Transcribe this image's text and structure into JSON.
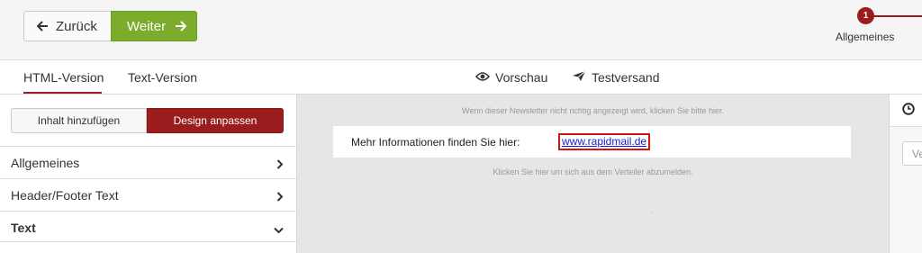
{
  "toolbar": {
    "back_label": "Zurück",
    "next_label": "Weiter",
    "step": {
      "number": "1",
      "label": "Allgemeines"
    }
  },
  "tabs": {
    "html_label": "HTML-Version",
    "text_label": "Text-Version",
    "preview_label": "Vorschau",
    "testsend_label": "Testversand"
  },
  "sidebar": {
    "segment": {
      "add_content": "Inhalt hinzufügen",
      "customize_design": "Design anpassen"
    },
    "items": [
      {
        "label": "Allgemeines"
      },
      {
        "label": "Header/Footer Text"
      },
      {
        "label": "Text"
      }
    ]
  },
  "preview": {
    "notice": "Wenn dieser Newsletter nicht richtig angezeigt wird, klicken Sie bitte hier.",
    "body_text": "Mehr Informationen finden Sie hier:",
    "link_text": "www.rapidmail.de",
    "unsubscribe": "Klicken Sie hier um sich aus dem Verteiler abzumelden."
  },
  "right_panel": {
    "field_text": "Ve"
  },
  "colors": {
    "accent_red": "#9b1c1c",
    "next_green": "#7cac2b",
    "link_blue": "#1a1adb",
    "highlight_red": "#d01515"
  },
  "icons": {
    "back": "arrow-left-icon",
    "next": "arrow-right-icon",
    "preview": "eye-icon",
    "testsend": "paper-plane-icon",
    "chevron_right": "chevron-right-icon",
    "chevron_down": "chevron-down-icon",
    "clock": "clock-icon"
  }
}
